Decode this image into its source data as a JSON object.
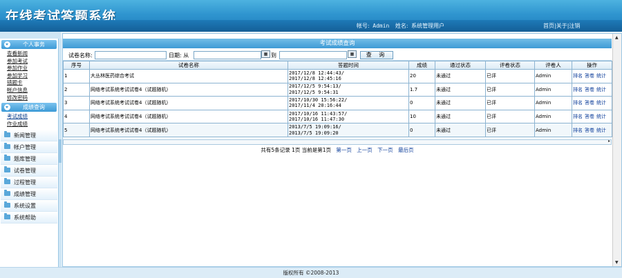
{
  "header": {
    "title": "在线考试答题系统",
    "account_label": "帐号:",
    "account_value": "Admin",
    "name_label": "姓名:",
    "name_value": "系统管理用户",
    "links": "首页|关于|注销"
  },
  "sidebar": {
    "group1": {
      "title": "个人事务",
      "items": [
        "查看新闻",
        "参加考试",
        "参加作业",
        "参加学习",
        "错题卡",
        "帐户信息",
        "修改密码"
      ]
    },
    "group2": {
      "title": "成绩查询",
      "items": [
        "考试成绩",
        "作业成绩"
      ]
    },
    "menus": [
      "新闻管理",
      "帐户管理",
      "题库管理",
      "试卷管理",
      "过程管理",
      "成绩管理",
      "系统设置",
      "系统帮助"
    ]
  },
  "panel": {
    "title": "考试成绩查询",
    "filter": {
      "paper_name_label": "试卷名称:",
      "date_label": "日期: 从",
      "to_label": "到",
      "query_button": "查 询",
      "calendar_glyph": "▦"
    }
  },
  "table": {
    "headers": [
      "序号",
      "试卷名称",
      "答题时间",
      "成绩",
      "通过状态",
      "评卷状态",
      "评卷人",
      "操作"
    ],
    "rows": [
      {
        "no": "1",
        "name": "大丛林医药综合考试",
        "time1": "2017/12/8 12:44:43/",
        "time2": "2017/12/8 12:45:16",
        "score": "20",
        "pass": "未通过",
        "review": "已评",
        "reviewer": "Admin"
      },
      {
        "no": "2",
        "name": "网络考试系统考试试卷4（试题随机）",
        "time1": "2017/12/5 9:54:13/",
        "time2": "2017/12/5 9:54:31",
        "score": "1.7",
        "pass": "未通过",
        "review": "已评",
        "reviewer": "Admin"
      },
      {
        "no": "3",
        "name": "网络考试系统考试试卷4（试题随机）",
        "time1": "2017/10/30 15:56:22/",
        "time2": "2017/11/4 20:16:44",
        "score": "0",
        "pass": "未通过",
        "review": "已评",
        "reviewer": "Admin"
      },
      {
        "no": "4",
        "name": "网络考试系统考试试卷4（试题随机）",
        "time1": "2017/10/16 11:43:57/",
        "time2": "2017/10/16 11:47:30",
        "score": "10",
        "pass": "未通过",
        "review": "已评",
        "reviewer": "Admin"
      },
      {
        "no": "5",
        "name": "网络考试系统考试试卷4（试题随机）",
        "time1": "2013/7/5 19:09:16/",
        "time2": "2013/7/5 19:09:20",
        "score": "0",
        "pass": "未通过",
        "review": "已评",
        "reviewer": "Admin"
      }
    ],
    "ops": [
      "排名",
      "答卷",
      "统计"
    ]
  },
  "pager": {
    "summary": "共有5条记录 1页 当前是第1页",
    "first": "第一页",
    "prev": "上一页",
    "next": "下一页",
    "last": "最后页"
  },
  "footer": {
    "text": "版权所有 ©2008-2013"
  }
}
